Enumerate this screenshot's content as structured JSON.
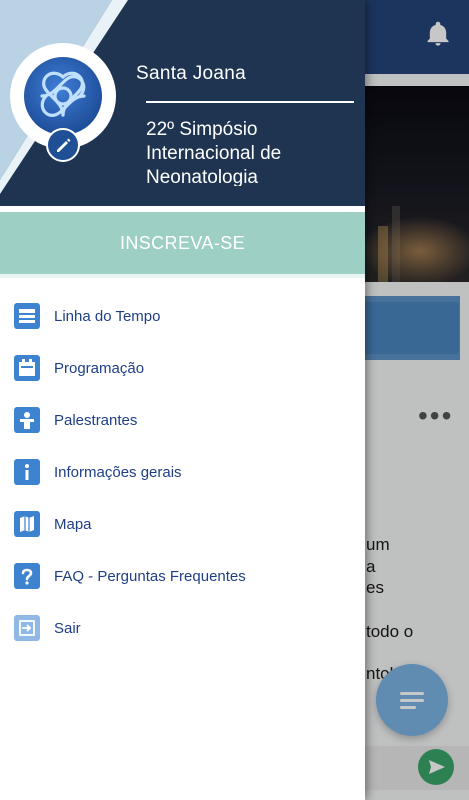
{
  "drawer": {
    "org_name": "Santa Joana",
    "event_title": "22º Simpósio Internacional de Neonatologia",
    "cta_label": "INSCREVA-SE",
    "items": [
      {
        "label": "Linha do Tempo",
        "icon": "timeline-icon"
      },
      {
        "label": "Programação",
        "icon": "calendar-icon"
      },
      {
        "label": "Palestrantes",
        "icon": "speaker-icon"
      },
      {
        "label": "Informações gerais",
        "icon": "info-icon"
      },
      {
        "label": "Mapa",
        "icon": "map-icon"
      },
      {
        "label": "FAQ - Perguntas Frequentes",
        "icon": "faq-icon"
      },
      {
        "label": "Sair",
        "icon": "logout-icon"
      }
    ]
  },
  "background": {
    "snippets": [
      "um",
      "a",
      "es",
      "todo o",
      "ntol"
    ]
  },
  "colors": {
    "header_navy": "#1e3451",
    "cta_teal": "#9dcfc4",
    "menu_icon_blue": "#3d83cf",
    "menu_text_blue": "#1f3f86",
    "topbar_blue": "#25447a"
  }
}
